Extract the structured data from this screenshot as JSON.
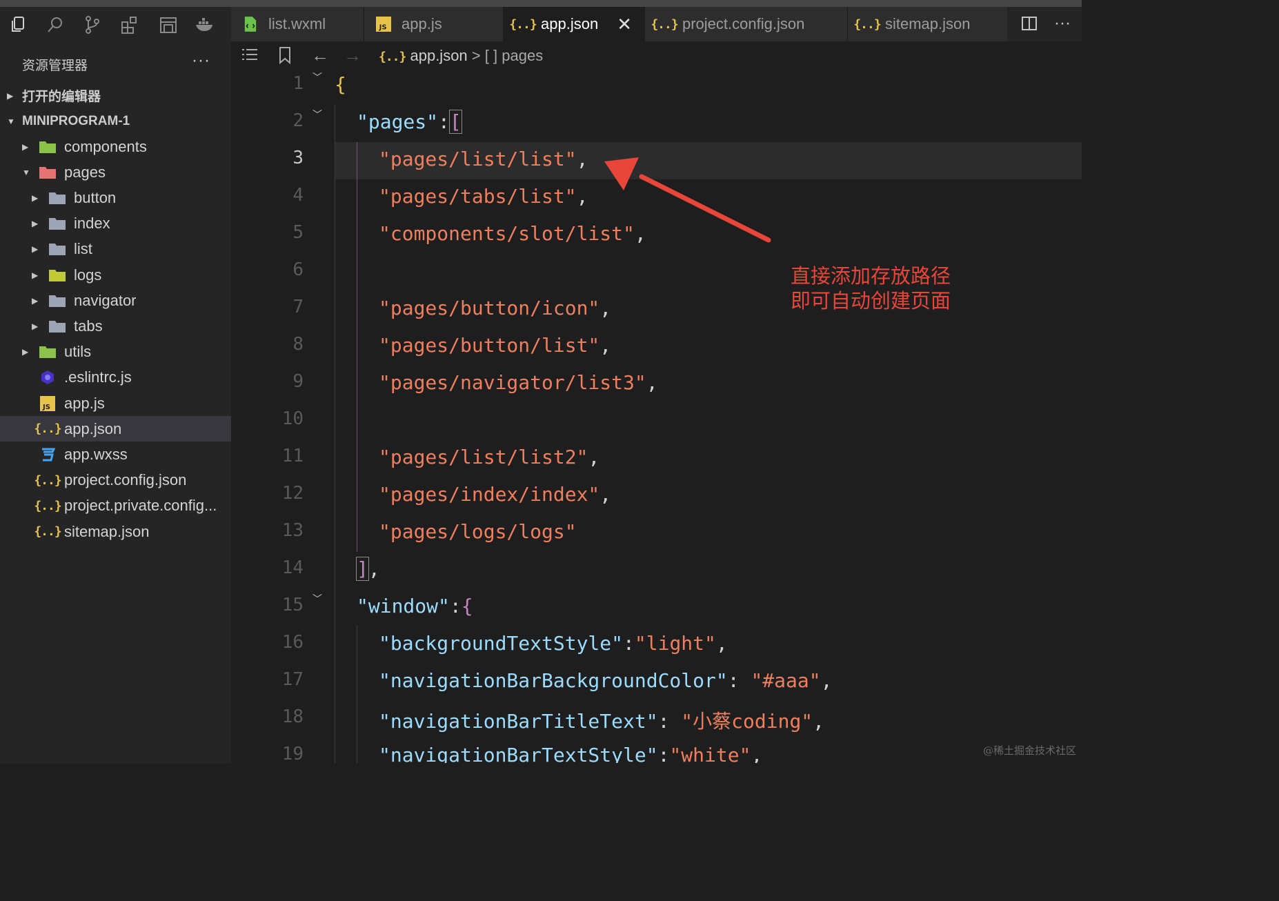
{
  "toolbar": {
    "icons": [
      "explorer-icon",
      "search-icon",
      "source-control-icon",
      "extensions-icon",
      "save-icon",
      "docker-icon"
    ]
  },
  "tabs": [
    {
      "label": "list.wxml",
      "icon": "wxml-file-icon",
      "active": false
    },
    {
      "label": "app.js",
      "icon": "js-file-icon",
      "active": false
    },
    {
      "label": "app.json",
      "icon": "json-file-icon",
      "active": true
    },
    {
      "label": "project.config.json",
      "icon": "json-file-icon",
      "active": false
    },
    {
      "label": "sitemap.json",
      "icon": "json-file-icon",
      "active": false
    }
  ],
  "sidebar": {
    "title": "资源管理器",
    "more": "···",
    "open_editors": "打开的编辑器",
    "project": "MINIPROGRAM-1",
    "tree": [
      {
        "label": "components",
        "type": "folder-green",
        "depth": 1,
        "expanded": false
      },
      {
        "label": "pages",
        "type": "folder-red",
        "depth": 1,
        "expanded": true
      },
      {
        "label": "button",
        "type": "folder",
        "depth": 2,
        "expanded": false
      },
      {
        "label": "index",
        "type": "folder",
        "depth": 2,
        "expanded": false
      },
      {
        "label": "list",
        "type": "folder",
        "depth": 2,
        "expanded": false
      },
      {
        "label": "logs",
        "type": "folder-yellow",
        "depth": 2,
        "expanded": false
      },
      {
        "label": "navigator",
        "type": "folder",
        "depth": 2,
        "expanded": false
      },
      {
        "label": "tabs",
        "type": "folder",
        "depth": 2,
        "expanded": false
      },
      {
        "label": "utils",
        "type": "folder-green",
        "depth": 1,
        "expanded": false
      },
      {
        "label": ".eslintrc.js",
        "type": "eslint",
        "depth": 1
      },
      {
        "label": "app.js",
        "type": "js",
        "depth": 1
      },
      {
        "label": "app.json",
        "type": "json",
        "depth": 1,
        "selected": true
      },
      {
        "label": "app.wxss",
        "type": "css",
        "depth": 1
      },
      {
        "label": "project.config.json",
        "type": "json",
        "depth": 1
      },
      {
        "label": "project.private.config...",
        "type": "json",
        "depth": 1
      },
      {
        "label": "sitemap.json",
        "type": "json",
        "depth": 1
      }
    ]
  },
  "breadcrumb": {
    "file": "app.json",
    "separator": ">",
    "section_icon": "[ ]",
    "section": "pages"
  },
  "editor": {
    "current_line": 3,
    "lines": [
      {
        "n": "1",
        "fold": true
      },
      {
        "n": "2",
        "fold": true
      },
      {
        "n": "3"
      },
      {
        "n": "4"
      },
      {
        "n": "5"
      },
      {
        "n": "6"
      },
      {
        "n": "7"
      },
      {
        "n": "8"
      },
      {
        "n": "9"
      },
      {
        "n": "10"
      },
      {
        "n": "11"
      },
      {
        "n": "12"
      },
      {
        "n": "13"
      },
      {
        "n": "14"
      },
      {
        "n": "15",
        "fold": true
      },
      {
        "n": "16"
      },
      {
        "n": "17"
      },
      {
        "n": "18"
      },
      {
        "n": "19"
      }
    ],
    "code": {
      "l1": "{",
      "l2_key": "\"pages\"",
      "l2_colon": ":",
      "l2_bracket": "[",
      "pages": [
        "\"pages/list/list\"",
        "\"pages/tabs/list\"",
        "\"components/slot/list\"",
        "\"pages/button/icon\"",
        "\"pages/button/list\"",
        "\"pages/navigator/list3\"",
        "\"pages/list/list2\"",
        "\"pages/index/index\"",
        "\"pages/logs/logs\""
      ],
      "comma": ",",
      "l14_bracket": "]",
      "l15_key": "\"window\"",
      "l15_colon": ":",
      "l15_brace": "{",
      "l16_key": "\"backgroundTextStyle\"",
      "l16_val": "\"light\"",
      "l17_key": "\"navigationBarBackgroundColor\"",
      "l17_val": "\"#aaa\"",
      "l18_key": "\"navigationBarTitleText\"",
      "l18_val": "\"小蔡coding\"",
      "l19_key": "\"navigationBarTextStyle\"",
      "l19_val": "\"white\""
    }
  },
  "annotation": {
    "line1": "直接添加存放路径",
    "line2": "即可自动创建页面",
    "color": "#e8463a"
  },
  "watermark": "@稀土掘金技术社区",
  "colors": {
    "key": "#9cdcfe",
    "string": "#f07f5e",
    "bracket": "#c586c0",
    "brace": "#e8c34a",
    "background": "#1e1e1e"
  }
}
